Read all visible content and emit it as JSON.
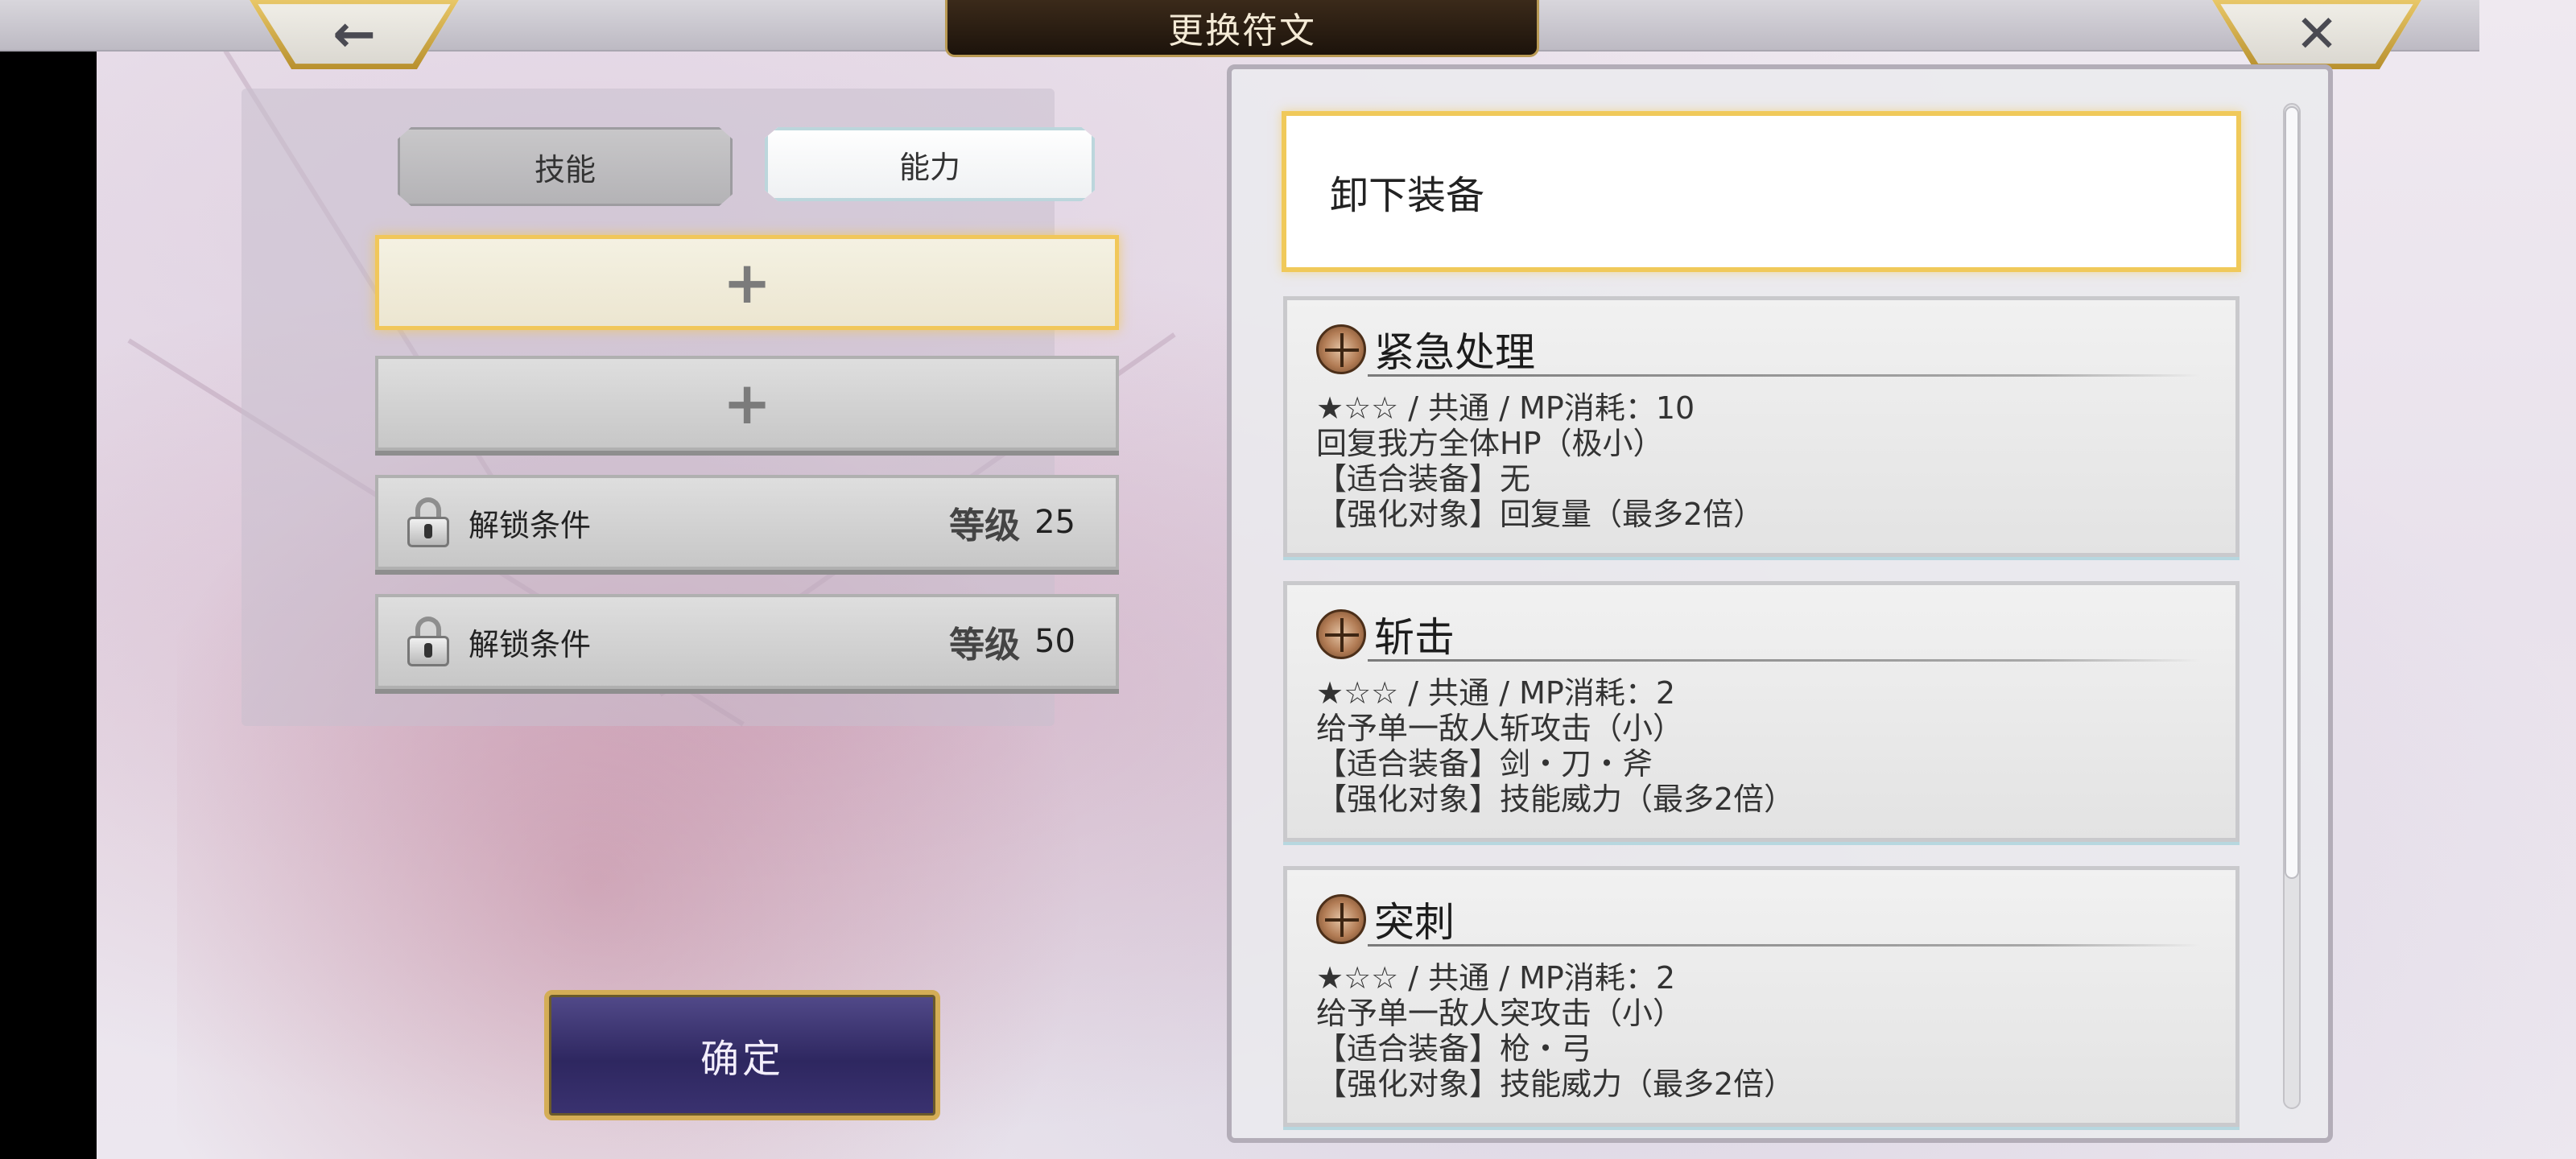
{
  "header": {
    "title": "更换符文",
    "back_glyph": "←",
    "close_glyph": "✕"
  },
  "left": {
    "tabs": [
      {
        "label": "技能",
        "active": false
      },
      {
        "label": "能力",
        "active": true
      }
    ],
    "slots": [
      {
        "type": "empty",
        "glyph": "+",
        "selected": true
      },
      {
        "type": "empty",
        "glyph": "+",
        "selected": false
      },
      {
        "type": "locked",
        "label": "解锁条件",
        "level_label": "等级",
        "level_value": "25"
      },
      {
        "type": "locked",
        "label": "解锁条件",
        "level_label": "等级",
        "level_value": "50"
      }
    ],
    "confirm_label": "确定"
  },
  "right": {
    "unequip_label": "卸下装备",
    "runes": [
      {
        "name": "紧急处理",
        "icon": "rune-icon",
        "lines": [
          "★☆☆ / 共通 / MP消耗：10",
          "回复我方全体HP（极小）",
          "【适合装备】无",
          "【强化对象】回复量（最多2倍）"
        ]
      },
      {
        "name": "斩击",
        "icon": "rune-icon",
        "lines": [
          "★☆☆ / 共通 / MP消耗：2",
          "给予单一敌人斩攻击（小）",
          "【适合装备】剑・刀・斧",
          "【强化对象】技能威力（最多2倍）"
        ]
      },
      {
        "name": "突刺",
        "icon": "rune-icon",
        "lines": [
          "★☆☆ / 共通 / MP消耗：2",
          "给予单一敌人突攻击（小）",
          "【适合装备】枪・弓",
          "【强化对象】技能威力（最多2倍）"
        ]
      }
    ]
  },
  "colors": {
    "gold_accent": "#f0c95a",
    "confirm_purple": "#2e2760",
    "title_plate": "#1c130b"
  }
}
